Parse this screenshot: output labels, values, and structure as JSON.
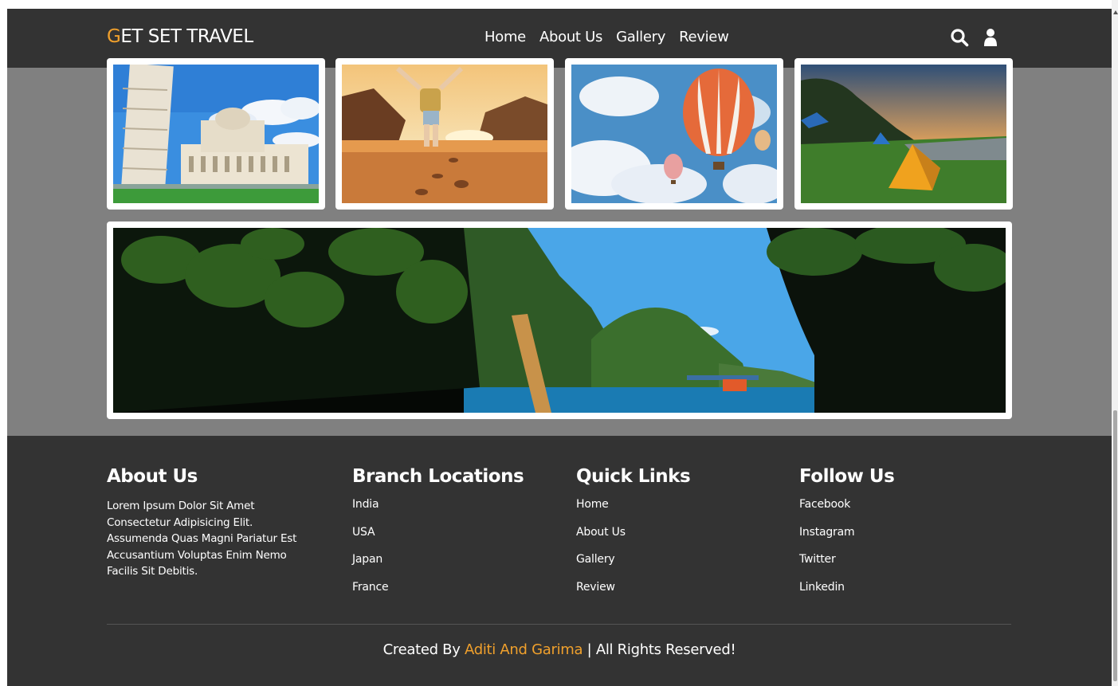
{
  "header": {
    "logo_first": "G",
    "logo_rest": "ET SET TRAVEL",
    "nav": [
      "Home",
      "About Us",
      "Gallery",
      "Review"
    ],
    "icons": [
      "search-icon",
      "user-icon"
    ]
  },
  "gallery": {
    "images": [
      "leaning-tower-pisa-image",
      "traveler-beach-image",
      "hot-air-balloon-image",
      "camping-tent-image",
      "island-lagoon-image"
    ]
  },
  "footer": {
    "about": {
      "title": "About Us",
      "text": "Lorem Ipsum Dolor Sit Amet Consectetur Adipisicing Elit. Assumenda Quas Magni Pariatur Est Accusantium Voluptas Enim Nemo Facilis Sit Debitis."
    },
    "branches": {
      "title": "Branch Locations",
      "items": [
        "India",
        "USA",
        "Japan",
        "France"
      ]
    },
    "quick_links": {
      "title": "Quick Links",
      "items": [
        "Home",
        "About Us",
        "Gallery",
        "Review"
      ]
    },
    "follow": {
      "title": "Follow Us",
      "items": [
        "Facebook",
        "Instagram",
        "Twitter",
        "Linkedin"
      ]
    },
    "credit_prefix": "Created By ",
    "credit_names": "Aditi And Garima",
    "credit_suffix": " | All Rights Reserved!"
  },
  "colors": {
    "accent": "#f0a02c",
    "dark": "#333333",
    "gallery_bg": "#808080"
  }
}
